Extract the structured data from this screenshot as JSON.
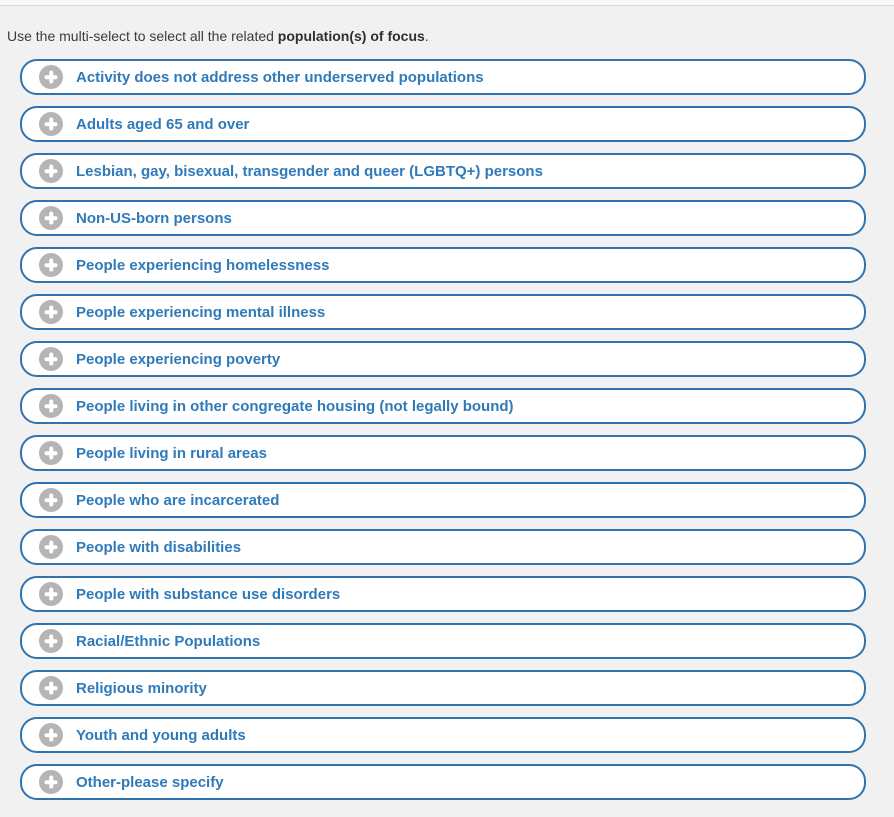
{
  "intro": {
    "prefix": "Use the multi-select to select all the related ",
    "bold": "population(s) of focus",
    "suffix": "."
  },
  "icons": {
    "option_icon": "plus-icon"
  },
  "colors": {
    "option_border": "#3173ad",
    "option_text": "#2f7ab9",
    "plus_circle": "#b5b5b5",
    "page_background": "#f1f1f1"
  },
  "items": [
    "Activity does not address other underserved populations",
    "Adults aged 65 and over",
    "Lesbian, gay, bisexual, transgender and queer (LGBTQ+) persons",
    "Non-US-born persons",
    "People experiencing homelessness",
    "People experiencing mental illness",
    "People experiencing poverty",
    "People living in other congregate housing (not legally bound)",
    "People living in rural areas",
    "People who are incarcerated",
    "People with disabilities",
    "People with substance use disorders",
    "Racial/Ethnic Populations",
    "Religious minority",
    "Youth and young adults",
    "Other-please specify"
  ]
}
